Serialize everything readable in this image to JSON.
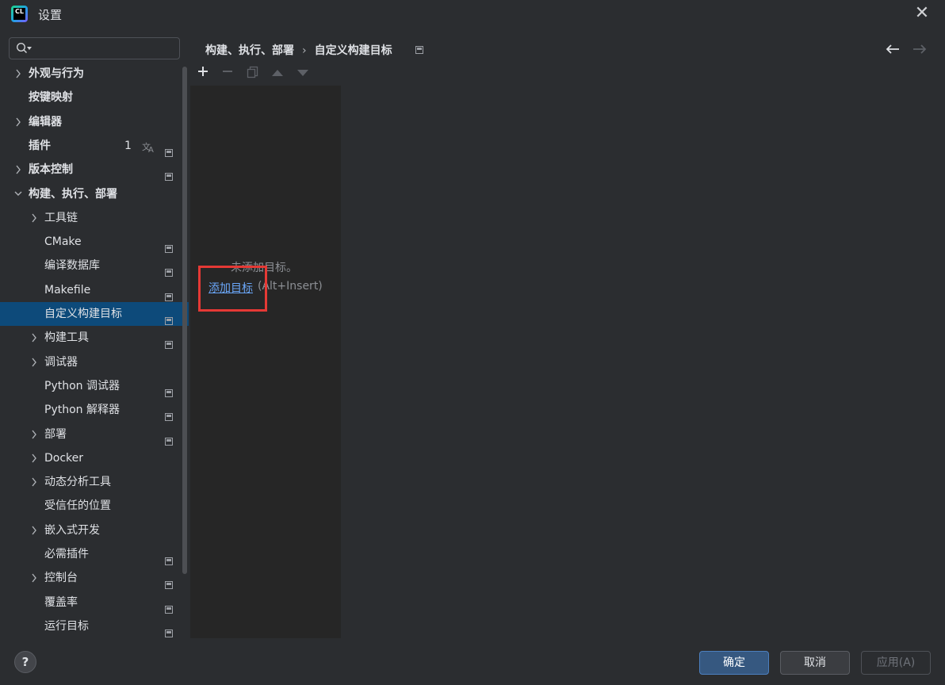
{
  "window": {
    "title": "设置",
    "logo_text": "CL"
  },
  "search": {
    "value": "",
    "placeholder": ""
  },
  "sidebar": {
    "items": [
      {
        "label": "外观与行为",
        "expandable": true,
        "bold": true,
        "level": 0
      },
      {
        "label": "按键映射",
        "expandable": false,
        "bold": true,
        "level": 0
      },
      {
        "label": "编辑器",
        "expandable": true,
        "bold": true,
        "level": 0
      },
      {
        "label": "插件",
        "expandable": false,
        "bold": true,
        "level": 0,
        "count": "1",
        "translate_icon": "translate-icon",
        "project_indicator": true
      },
      {
        "label": "版本控制",
        "expandable": true,
        "bold": true,
        "level": 0,
        "project_indicator": true
      },
      {
        "label": "构建、执行、部署",
        "expandable": true,
        "expanded": true,
        "bold": true,
        "level": 0
      },
      {
        "label": "工具链",
        "expandable": true,
        "level": 1
      },
      {
        "label": "CMake",
        "expandable": false,
        "level": 1,
        "project_indicator": true
      },
      {
        "label": "编译数据库",
        "expandable": false,
        "level": 1,
        "project_indicator": true
      },
      {
        "label": "Makefile",
        "expandable": false,
        "level": 1,
        "project_indicator": true
      },
      {
        "label": "自定义构建目标",
        "expandable": false,
        "level": 1,
        "project_indicator": true,
        "selected": true
      },
      {
        "label": "构建工具",
        "expandable": true,
        "level": 1,
        "project_indicator": true
      },
      {
        "label": "调试器",
        "expandable": true,
        "level": 1
      },
      {
        "label": "Python 调试器",
        "expandable": false,
        "level": 1,
        "project_indicator": true
      },
      {
        "label": "Python 解释器",
        "expandable": false,
        "level": 1,
        "project_indicator": true
      },
      {
        "label": "部署",
        "expandable": true,
        "level": 1,
        "project_indicator": true
      },
      {
        "label": "Docker",
        "expandable": true,
        "level": 1
      },
      {
        "label": "动态分析工具",
        "expandable": true,
        "level": 1
      },
      {
        "label": "受信任的位置",
        "expandable": false,
        "level": 1
      },
      {
        "label": "嵌入式开发",
        "expandable": true,
        "level": 1
      },
      {
        "label": "必需插件",
        "expandable": false,
        "level": 1,
        "project_indicator": true
      },
      {
        "label": "控制台",
        "expandable": true,
        "level": 1,
        "project_indicator": true
      },
      {
        "label": "覆盖率",
        "expandable": false,
        "level": 1,
        "project_indicator": true
      },
      {
        "label": "运行目标",
        "expandable": false,
        "level": 1,
        "project_indicator": true
      }
    ]
  },
  "breadcrumb": {
    "parent": "构建、执行、部署",
    "separator": "›",
    "current": "自定义构建目标"
  },
  "toolbar": {
    "add": "+",
    "remove": "−"
  },
  "content": {
    "empty_text": "未添加目标。",
    "add_link": "添加目标",
    "shortcut": "(Alt+Insert)"
  },
  "footer": {
    "help": "?",
    "ok": "确定",
    "cancel": "取消",
    "apply": "应用(A)"
  },
  "colors": {
    "background": "#2b2d30",
    "panel": "#262626",
    "selection": "#0d4a7a",
    "link": "#6aa6f8",
    "highlight": "#e53935",
    "primary_button": "#365880"
  }
}
